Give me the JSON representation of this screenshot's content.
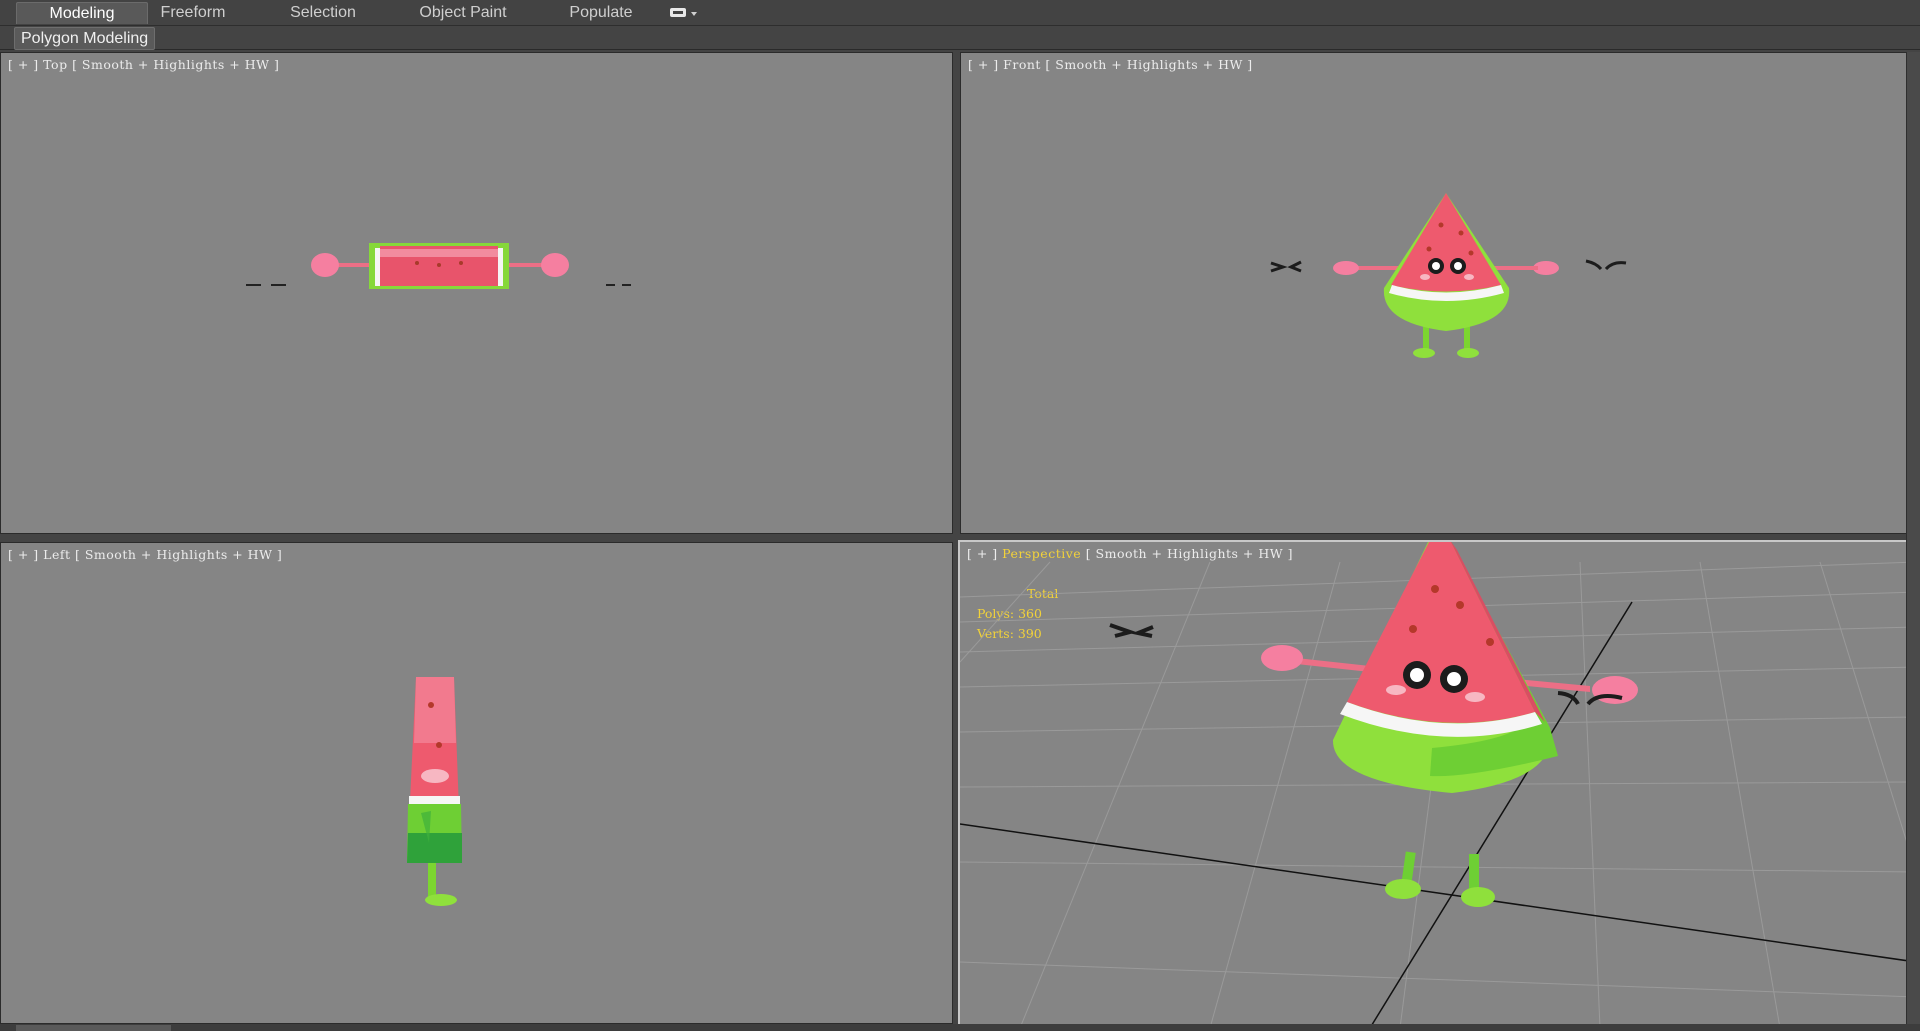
{
  "ribbon": {
    "tabs": [
      {
        "label": "Modeling"
      },
      {
        "label": "Freeform"
      },
      {
        "label": "Selection"
      },
      {
        "label": "Object Paint"
      },
      {
        "label": "Populate"
      }
    ],
    "subtab": "Polygon Modeling"
  },
  "viewports": {
    "top": {
      "plus": "[ + ]",
      "view": "Top",
      "shading": "[ Smooth + Highlights + HW ]"
    },
    "front": {
      "plus": "[ + ]",
      "view": "Front",
      "shading": "[ Smooth + Highlights + HW ]"
    },
    "left": {
      "plus": "[ + ]",
      "view": "Left",
      "shading": "[ Smooth + Highlights + HW ]"
    },
    "persp": {
      "plus": "[ + ]",
      "view": "Perspective",
      "shading": "[ Smooth + Highlights + HW ]"
    }
  },
  "stats": {
    "total": "Total",
    "polys": "Polys: 360",
    "verts": "Verts: 390"
  },
  "colors": {
    "viewport_bg": "#858585",
    "label_highlight": "#f2d23a",
    "melon_red": "#ee5a6e",
    "melon_green": "#8fe03c"
  }
}
